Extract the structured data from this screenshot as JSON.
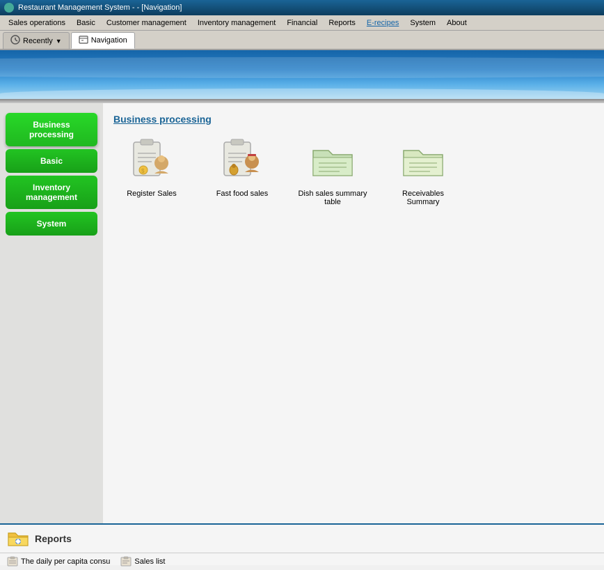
{
  "window": {
    "title": "Restaurant Management System -  - [Navigation]",
    "title_icon": "app-icon"
  },
  "menu": {
    "items": [
      {
        "id": "sales-operations",
        "label": "Sales operations"
      },
      {
        "id": "basic",
        "label": "Basic"
      },
      {
        "id": "customer-management",
        "label": "Customer management"
      },
      {
        "id": "inventory-management",
        "label": "Inventory management"
      },
      {
        "id": "financial",
        "label": "Financial"
      },
      {
        "id": "reports",
        "label": "Reports"
      },
      {
        "id": "e-recipes",
        "label": "E-recipes"
      },
      {
        "id": "system",
        "label": "System"
      },
      {
        "id": "about",
        "label": "About"
      }
    ]
  },
  "tabs": [
    {
      "id": "recently",
      "label": "Recently",
      "icon": "clock-icon",
      "has_arrow": true,
      "active": false
    },
    {
      "id": "navigation",
      "label": "Navigation",
      "icon": "nav-icon",
      "active": true
    }
  ],
  "sidebar": {
    "buttons": [
      {
        "id": "business-processing",
        "label": "Business processing",
        "active": true
      },
      {
        "id": "basic",
        "label": "Basic",
        "active": false
      },
      {
        "id": "inventory-management",
        "label": "Inventory management",
        "active": false
      },
      {
        "id": "system",
        "label": "System",
        "active": false
      }
    ]
  },
  "business_processing": {
    "title": "Business processing",
    "icons": [
      {
        "id": "register-sales",
        "label": "Register Sales"
      },
      {
        "id": "fast-food-sales",
        "label": "Fast food sales"
      },
      {
        "id": "dish-sales-summary",
        "label": "Dish sales summary table"
      },
      {
        "id": "receivables-summary",
        "label": "Receivables Summary"
      }
    ]
  },
  "reports": {
    "title": "Reports",
    "links": [
      {
        "id": "daily-per-capita",
        "label": "The daily per capita consu"
      },
      {
        "id": "sales-list",
        "label": "Sales list"
      }
    ]
  }
}
